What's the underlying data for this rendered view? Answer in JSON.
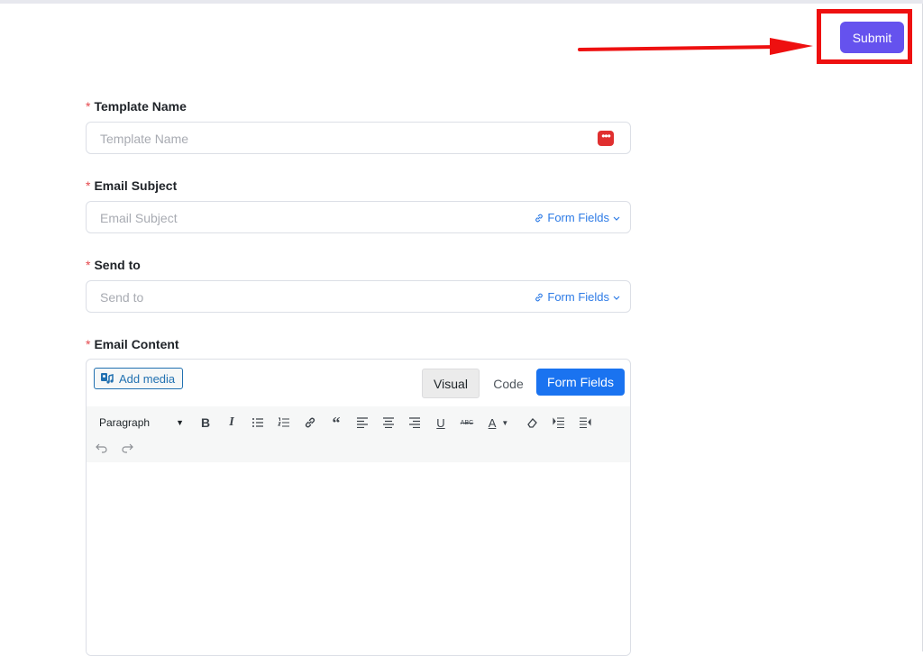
{
  "header": {
    "submit_label": "Submit"
  },
  "fields": {
    "template_name": {
      "required_mark": "*",
      "label": "Template Name",
      "placeholder": "Template Name"
    },
    "email_subject": {
      "required_mark": "*",
      "label": "Email Subject",
      "placeholder": "Email Subject",
      "form_fields_label": "Form Fields"
    },
    "send_to": {
      "required_mark": "*",
      "label": "Send to",
      "placeholder": "Send to",
      "form_fields_label": "Form Fields"
    },
    "email_content": {
      "required_mark": "*",
      "label": "Email Content"
    }
  },
  "editor": {
    "add_media_label": "Add media",
    "tabs": {
      "visual": "Visual",
      "code": "Code",
      "form_fields": "Form Fields"
    },
    "format_select_value": "Paragraph",
    "toolbar_icons": [
      "bold-icon",
      "italic-icon",
      "bullet-list-icon",
      "numbered-list-icon",
      "link-icon",
      "blockquote-icon",
      "align-left-icon",
      "align-center-icon",
      "align-right-icon",
      "underline-icon",
      "strikethrough-icon",
      "text-color-icon",
      "clear-formatting-icon",
      "indent-icon",
      "outdent-icon",
      "undo-icon",
      "redo-icon"
    ]
  },
  "colors": {
    "submit": "#6552ee",
    "highlight": "#ee1010",
    "required": "#e5484d",
    "link": "#2d7be6",
    "form_fields_tab": "#1a73f0"
  }
}
